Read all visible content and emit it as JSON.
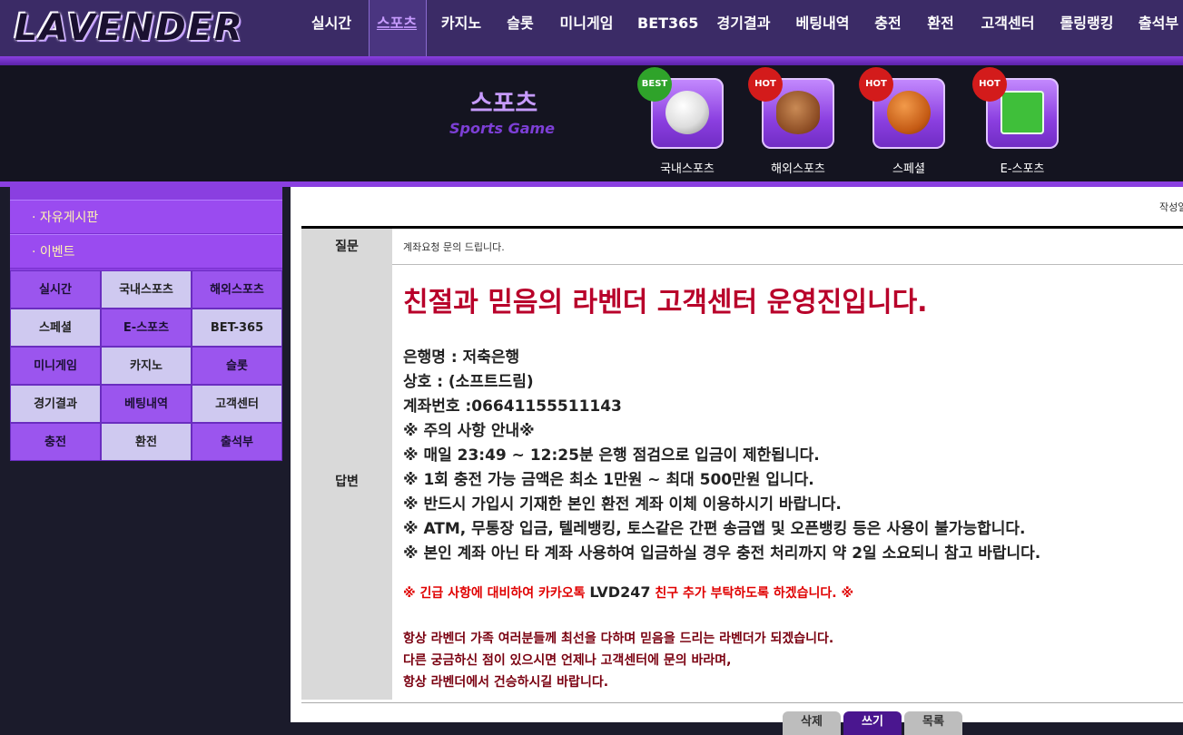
{
  "brand": {
    "logo_text": "LAVENDER"
  },
  "nav": {
    "items": [
      "실시간",
      "스포츠",
      "카지노",
      "슬롯",
      "미니게임",
      "BET365",
      "경기결과",
      "베팅내역",
      "충전",
      "환전",
      "고객센터",
      "롤링랭킹",
      "출석부"
    ],
    "active": "스포츠"
  },
  "banner": {
    "title": "스포츠",
    "subtitle": "Sports Game",
    "games": [
      {
        "label": "국내스포츠",
        "badge": "BEST",
        "icon": "soccer-ball-icon"
      },
      {
        "label": "해외스포츠",
        "badge": "HOT",
        "icon": "football-icon"
      },
      {
        "label": "스페셜",
        "badge": "HOT",
        "icon": "basketball-icon"
      },
      {
        "label": "E-스포츠",
        "badge": "HOT",
        "icon": "soccer-field-icon"
      }
    ]
  },
  "sidebar": {
    "links": [
      "· 자유게시판",
      "· 이벤트"
    ],
    "grid": [
      "실시간",
      "국내스포츠",
      "해외스포츠",
      "스페셜",
      "E-스포츠",
      "BET-365",
      "미니게임",
      "카지노",
      "슬롯",
      "경기결과",
      "베팅내역",
      "고객센터",
      "충전",
      "환전",
      "출석부"
    ]
  },
  "board": {
    "writer_label": "작성일",
    "question_label": "질문",
    "question_text": "계좌요청 문의 드립니다.",
    "answer_label": "답변",
    "answer_title": "친절과 믿음의 라벤더 고객센터 운영진입니다.",
    "answer_lines": [
      "은행명 : 저축은행",
      "상호 : (소프트드림)",
      "계좌번호 :06641155511143",
      "※ 주의 사항 안내※",
      "※ 매일 23:49 ~ 12:25분 은행 점검으로 입금이 제한됩니다.",
      "※ 1회 충전 가능 금액은 최소 1만원 ~ 최대 500만원 입니다.",
      "※ 반드시 가입시 기재한 본인 환전 계좌 이체 이용하시기 바랍니다.",
      "※ ATM, 무통장 입금, 텔레뱅킹, 토스같은 간편 송금앱 및 오픈뱅킹 등은 사용이 불가능합니다.",
      "※ 본인 계좌 아닌 타 계좌 사용하여 입금하실 경우 충전 처리까지 약 2일 소요되니 참고 바랍니다."
    ],
    "urgent_pre": "※ 긴급 사항에 대비하여 카카오톡 ",
    "urgent_id": "LVD247",
    "urgent_post": " 친구 추가 부탁하도록 하겠습니다. ※",
    "closing_lines": [
      "항상 라벤더 가족 여러분들께 최선을 다하며 믿음을 드리는 라벤더가 되겠습니다.",
      "다른 궁금하신 점이 있으시면 언제나 고객센터에 문의 바라며,",
      "항상 라벤더에서 건승하시길 바랍니다."
    ],
    "buttons": [
      "삭제",
      "쓰기",
      "목록"
    ]
  },
  "colors": {
    "accent": "#8a3fe0",
    "answer_title": "#b8002a",
    "urgent": "#e00000"
  }
}
